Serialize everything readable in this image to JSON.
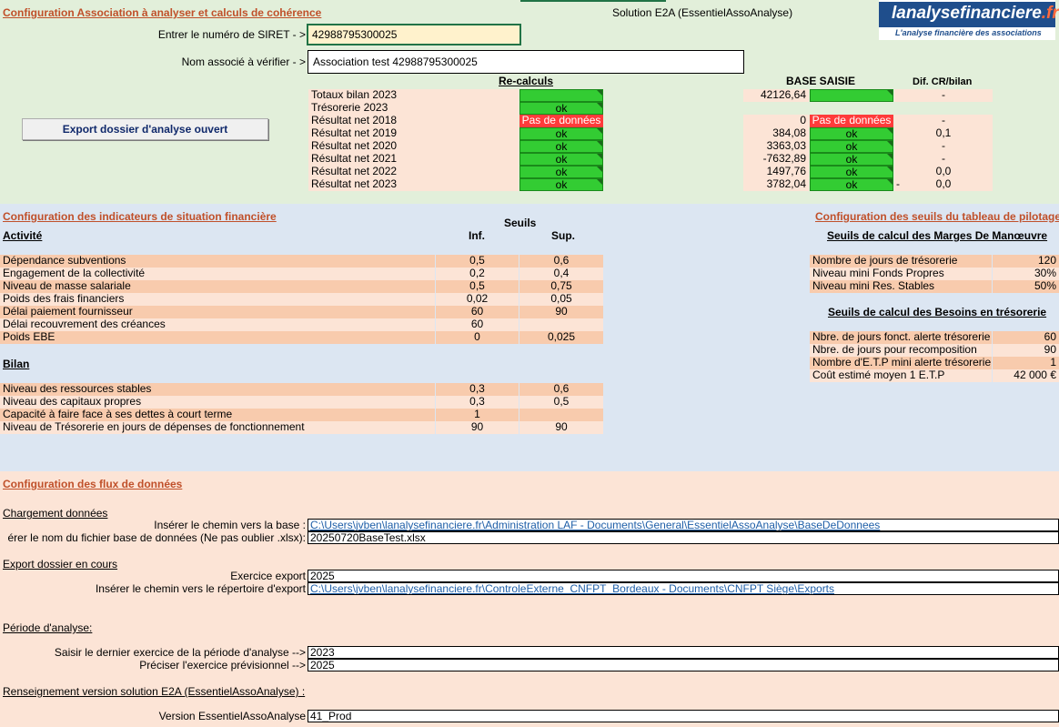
{
  "header": {
    "config_title": "Configuration Association à analyser et calculs de cohérence",
    "solution_label": "Solution E2A (EssentielAssoAnalyse)",
    "logo_main": "lanalysefinanciere",
    "logo_ext": ".fr",
    "logo_tagline": "L'analyse financière des associations",
    "siret_label": "Entrer le numéro de  SIRET - >",
    "siret_value": "42988795300025",
    "name_label": "Nom associé à vérifier - >",
    "name_value": "Association test 42988795300025",
    "export_button": "Export dossier d'analyse ouvert"
  },
  "coherence": {
    "recalc_header": "Re-calculs",
    "base_header": "BASE SAISIE",
    "dif_header": "Dif. CR/bilan",
    "rows": [
      {
        "label": "Totaux bilan 2023",
        "recalc": "",
        "recalc_state": "green",
        "base": "42126,64",
        "base_status": "",
        "base_state": "green",
        "dif": "-",
        "dif_prefix": ""
      },
      {
        "label": "Trésorerie 2023",
        "recalc": "ok",
        "recalc_state": "green",
        "base": "",
        "base_status": "",
        "base_state": "none",
        "dif": "",
        "dif_prefix": ""
      },
      {
        "label": "Résultat net 2018",
        "recalc": "Pas de données",
        "recalc_state": "red",
        "base": "0",
        "base_status": "Pas de données",
        "base_state": "red",
        "dif": "-",
        "dif_prefix": ""
      },
      {
        "label": "Résultat net 2019",
        "recalc": "ok",
        "recalc_state": "green",
        "base": "384,08",
        "base_status": "ok",
        "base_state": "green",
        "dif": "0,1",
        "dif_prefix": ""
      },
      {
        "label": "Résultat net 2020",
        "recalc": "ok",
        "recalc_state": "green",
        "base": "3363,03",
        "base_status": "ok",
        "base_state": "green",
        "dif": "-",
        "dif_prefix": ""
      },
      {
        "label": "Résultat net 2021",
        "recalc": "ok",
        "recalc_state": "green",
        "base": "-7632,89",
        "base_status": "ok",
        "base_state": "green",
        "dif": "-",
        "dif_prefix": ""
      },
      {
        "label": "Résultat net 2022",
        "recalc": "ok",
        "recalc_state": "green",
        "base": "1497,76",
        "base_status": "ok",
        "base_state": "green",
        "dif": "0,0",
        "dif_prefix": ""
      },
      {
        "label": "Résultat net 2023",
        "recalc": "ok",
        "recalc_state": "green",
        "base": "3782,04",
        "base_status": "ok",
        "base_state": "green",
        "dif": "0,0",
        "dif_prefix": "-"
      }
    ]
  },
  "indicators": {
    "title": "Configuration des indicateurs de situation financière",
    "seuils_label": "Seuils",
    "activite_label": "Activité",
    "inf_label": "Inf.",
    "sup_label": "Sup.",
    "activite_rows": [
      {
        "label": "Dépendance subventions",
        "inf": "0,5",
        "sup": "0,6"
      },
      {
        "label": "Engagement de la collectivité",
        "inf": "0,2",
        "sup": "0,4"
      },
      {
        "label": "Niveau de masse salariale",
        "inf": "0,5",
        "sup": "0,75"
      },
      {
        "label": "Poids des frais financiers",
        "inf": "0,02",
        "sup": "0,05"
      },
      {
        "label": "Délai paiement fournisseur",
        "inf": "60",
        "sup": "90"
      },
      {
        "label": "Délai recouvrement des créances",
        "inf": "60",
        "sup": ""
      },
      {
        "label": "Poids EBE",
        "inf": "0",
        "sup": "0,025"
      }
    ],
    "bilan_label": "Bilan",
    "bilan_rows": [
      {
        "label": "Niveau des ressources stables",
        "inf": "0,3",
        "sup": "0,6"
      },
      {
        "label": "Niveau des capitaux propres",
        "inf": "0,3",
        "sup": "0,5"
      },
      {
        "label": "Capacité à faire face à ses dettes à court terme",
        "inf": "1",
        "sup": ""
      },
      {
        "label": "Niveau de Trésorerie en jours de  dépenses de fonctionnement",
        "inf": "90",
        "sup": "90"
      }
    ]
  },
  "pilotage": {
    "title": "Configuration des seuils du tableau de pilotage",
    "marges_title": "Seuils de calcul des Marges De Manœuvre",
    "marges_rows": [
      {
        "label": "Nombre de jours de trésorerie",
        "value": "120"
      },
      {
        "label": "Niveau mini Fonds Propres",
        "value": "30%"
      },
      {
        "label": "Niveau mini Res. Stables",
        "value": "50%"
      }
    ],
    "besoins_title": "Seuils de calcul des Besoins en trésorerie",
    "besoins_rows": [
      {
        "label": "Nbre. de jours fonct. alerte trésorerie",
        "value": "60"
      },
      {
        "label": "Nbre. de jours pour recomposition",
        "value": "90"
      },
      {
        "label": "Nombre d'E.T.P mini alerte trésorerie",
        "value": "1"
      },
      {
        "label": "Coût estimé moyen 1 E.T.P",
        "value": "42 000 €"
      }
    ]
  },
  "flux": {
    "title": "Configuration des flux de données",
    "chargement_label": "Chargement données",
    "chemin_base_label": "Insérer le chemin vers la base :",
    "chemin_base_value": "C:\\Users\\jvben\\lanalysefinanciere.fr\\Administration LAF - Documents\\General\\EssentielAssoAnalyse\\BaseDeDonnees",
    "fichier_label": "érer le nom du fichier base de données (Ne pas oublier .xlsx):",
    "fichier_value": "20250720BaseTest.xlsx",
    "export_label": "Export dossier en cours",
    "exercice_export_label": "Exercice export",
    "exercice_export_value": "2025",
    "chemin_export_label": "Insérer le chemin vers le répertoire d'export",
    "chemin_export_value": "C:\\Users\\jvben\\lanalysefinanciere.fr\\ControleExterne_CNFPT_Bordeaux - Documents\\CNFPT Siège\\Exports",
    "periode_label": "Période d'analyse:",
    "dernier_label": "Saisir le dernier exercice de la période d'analyse -->",
    "dernier_value": "2023",
    "previsionnel_label": "Préciser l'exercice prévisionnel -->",
    "previsionnel_value": "2025",
    "version_section_label": "Renseignement version solution E2A (EssentielAssoAnalyse) :",
    "version_label": "Version EssentielAssoAnalyse",
    "version_value": "41_Prod"
  },
  "colors": {
    "top_bg": "#e2efda",
    "blue_bg": "#dce6f2",
    "peach_bg": "#fce4d6",
    "pink_cell": "#f8cbad",
    "ok_green": "#33cc33",
    "alert_red": "#ff3b3b",
    "title_orange": "#c0502a",
    "logo_blue": "#1f4e8c"
  }
}
